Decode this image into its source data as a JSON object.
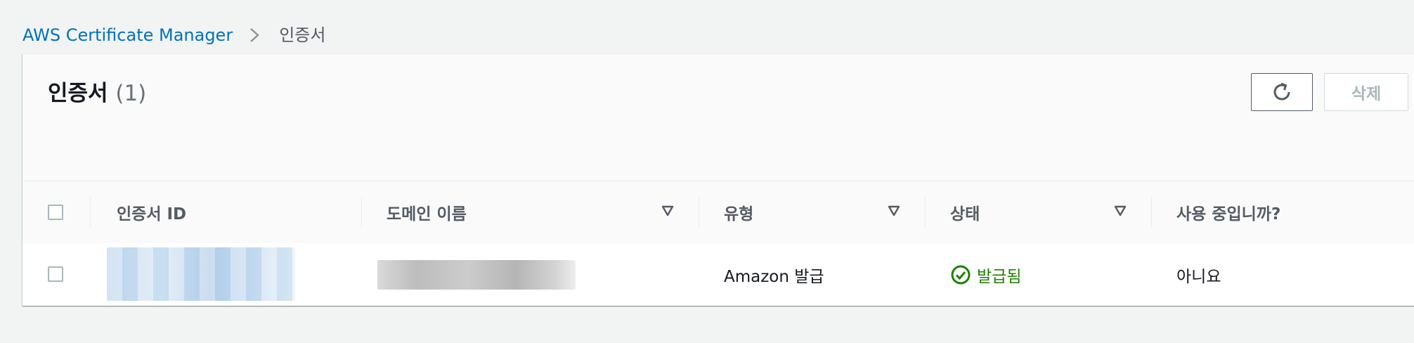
{
  "breadcrumb": {
    "service": "AWS Certificate Manager",
    "current": "인증서"
  },
  "panel": {
    "title": "인증서",
    "count": "(1)",
    "delete_label": "삭제"
  },
  "table": {
    "columns": {
      "certificate_id": "인증서 ID",
      "domain_name": "도메인 이름",
      "type": "유형",
      "status": "상태",
      "in_use": "사용 중입니까?"
    },
    "rows": [
      {
        "type": "Amazon 발급",
        "status": "발급됨",
        "in_use": "아니요"
      }
    ]
  },
  "colors": {
    "link": "#0073bb",
    "success": "#1d8102",
    "disabled": "#aab7b8"
  }
}
